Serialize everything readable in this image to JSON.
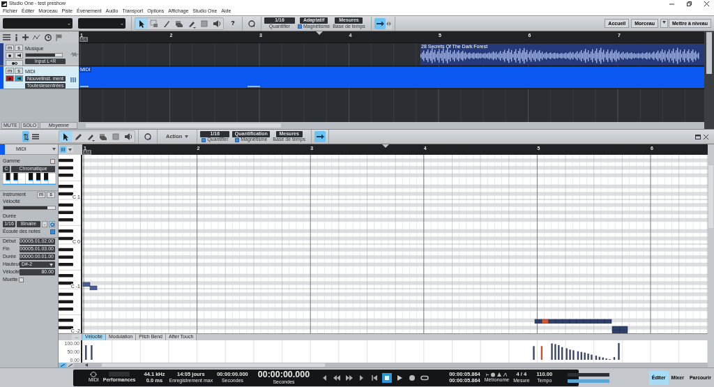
{
  "window": {
    "title": "Studio One - test preshow"
  },
  "menu": [
    "Fichier",
    "Éditer",
    "Morceau",
    "Piste",
    "Événement",
    "Audio",
    "Transport",
    "Options",
    "Affichage",
    "Studio One",
    "Aide"
  ],
  "toolbar": {
    "tools": [
      {
        "kind": "arrow",
        "selected": true
      },
      {
        "kind": "range",
        "selected": false
      },
      {
        "kind": "split",
        "selected": false
      },
      {
        "kind": "eraser",
        "selected": false
      },
      {
        "kind": "paint",
        "selected": false
      },
      {
        "kind": "mute",
        "selected": false
      },
      {
        "kind": "listen",
        "selected": false
      }
    ],
    "help": "?",
    "quantize": [
      {
        "value": "1/16",
        "label": "Quantifier"
      },
      {
        "value": "Adaptatif",
        "label": "Magnétisme",
        "checked": true
      },
      {
        "value": "Mesures",
        "label": "Base de temps"
      }
    ],
    "follow": {
      "on": true
    },
    "pages": [
      "Accueil",
      "Morceau",
      "Mettre à niveau"
    ]
  },
  "arrange": {
    "ruler": [
      "1",
      "2",
      "3",
      "4",
      "5",
      "6",
      "7"
    ],
    "time_signature": "4/4",
    "tracks": [
      {
        "kind": "audio",
        "name": "Musique",
        "selected": false,
        "buttons": [
          "m",
          "s"
        ],
        "record": false,
        "monitor": false,
        "input": "Input L+R",
        "clip": "28 Secrets Of The Dark Forest"
      },
      {
        "kind": "instrument",
        "name": "MIDI",
        "selected": true,
        "buttons": [
          "m",
          "s"
        ],
        "record": true,
        "monitor": true,
        "instrument": "Nouvelinst. ment",
        "input": "Touteslesentrées",
        "clip": "MIDI"
      }
    ],
    "footer": {
      "mute": "MUTE",
      "solo": "SOLO",
      "mode": "Moyenne"
    }
  },
  "editor": {
    "tools": [
      {
        "kind": "arrow",
        "selected": true
      },
      {
        "kind": "pencil",
        "selected": false
      },
      {
        "kind": "paint",
        "selected": false
      },
      {
        "kind": "eraser",
        "selected": false
      },
      {
        "kind": "mute",
        "selected": false
      },
      {
        "kind": "listen",
        "selected": false
      }
    ],
    "action": "Action",
    "quantize": [
      {
        "value": "1/16",
        "label": "Quantifier",
        "checked": true
      },
      {
        "value": "Quantification",
        "label": "Magnétisme",
        "checked": true
      },
      {
        "value": "Mesures",
        "label": "Base de temps"
      }
    ],
    "follow": {
      "on": true
    },
    "track": "MIDI",
    "ruler": [
      "1",
      "2",
      "3",
      "4",
      "5",
      "6"
    ],
    "time_signature": "4/4",
    "keys": [
      "C 1",
      "C 0",
      "C -1",
      "C -2"
    ],
    "inspector": {
      "scale_label": "Gamme",
      "scale_on": false,
      "root": "C",
      "scale": "Chromatique",
      "instrument_label": "Instrument",
      "buttons": [
        "m",
        "s"
      ],
      "velocity_label": "Vélocité",
      "velocity": {
        "level": 0.85
      },
      "duration_label": "Durée",
      "duration": "1/16",
      "feel": "Binaire",
      "minus": "-",
      "quantize_on": true,
      "listen_label": "Écoute des notes",
      "listen_on": true,
      "fields": [
        {
          "label": "Début",
          "value": "00005.01.02.00",
          "kind": "text"
        },
        {
          "label": "Fin",
          "value": "00005.01.03.00",
          "kind": "text"
        },
        {
          "label": "Durée",
          "value": "00000.00.01.00",
          "kind": "text"
        },
        {
          "label": "Hauteur",
          "value": "D#-2",
          "kind": "select"
        },
        {
          "label": "Vélocité",
          "value": "80.00",
          "kind": "text"
        }
      ],
      "mute_label": "Muette",
      "muted": false
    },
    "lane_more": "...",
    "lanes": [
      {
        "label": "Vélocité",
        "selected": true
      },
      {
        "label": "Modulation",
        "selected": false
      },
      {
        "label": "Pitch Bend",
        "selected": false
      },
      {
        "label": "After Touch",
        "selected": false
      }
    ],
    "velocity": {
      "axis_labels": [
        "100.00",
        "50.00",
        "0.00"
      ],
      "bars": [
        {
          "selected": false
        },
        {
          "selected": false
        },
        {
          "selected": false
        },
        {
          "selected": true
        },
        {
          "selected": false
        },
        {
          "selected": false
        },
        {
          "selected": false
        },
        {
          "selected": false
        },
        {
          "selected": false
        },
        {
          "selected": false
        },
        {
          "selected": false
        },
        {
          "selected": false
        },
        {
          "selected": false
        },
        {
          "selected": false
        },
        {
          "selected": false
        },
        {
          "selected": false
        },
        {
          "selected": false
        },
        {
          "selected": false
        },
        {
          "selected": false
        },
        {
          "selected": false
        },
        {
          "selected": false
        },
        {
          "selected": false
        },
        {
          "selected": false
        }
      ]
    }
  },
  "transport": {
    "midi": "MIDI",
    "performance": "Performances",
    "sample_rate": "44.1 kHz",
    "latency": "0.0 ms",
    "record_time": "14:05 jours",
    "record_label": "Enregistrement max",
    "secondary_time": "00:00:00.000",
    "secondary_unit": "Secondes",
    "time": "00:00:00.000",
    "time_unit": "Secondes",
    "buttons": [
      {
        "kind": "prev",
        "on": false
      },
      {
        "kind": "rewind",
        "on": false
      },
      {
        "kind": "forward",
        "on": false
      },
      {
        "kind": "next",
        "on": false
      },
      {
        "kind": "start",
        "on": false
      },
      {
        "kind": "stop",
        "on": true
      },
      {
        "kind": "play",
        "on": false
      },
      {
        "kind": "record",
        "on": false
      },
      {
        "kind": "loop",
        "on": false
      }
    ],
    "loop_start": "00:00:05.864",
    "loop_end": "00:00:05.864",
    "metronome": "Métronome",
    "signature": "4 / 4",
    "signature_label": "Mesure",
    "tempo": "110.00",
    "tempo_label": "Tempo"
  },
  "views": [
    {
      "label": "Éditer",
      "selected": true
    },
    {
      "label": "Mixer",
      "selected": false
    },
    {
      "label": "Parcourir",
      "selected": false
    }
  ]
}
